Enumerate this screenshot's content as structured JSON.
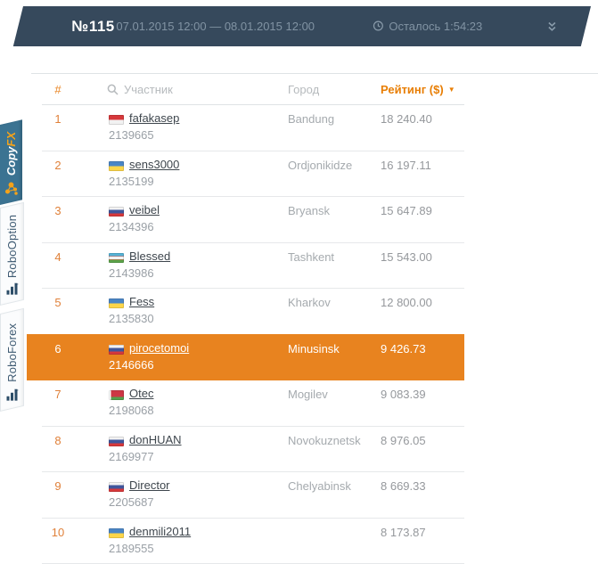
{
  "colors": {
    "topbar_bg": "#36495c",
    "accent_orange": "#e8821e",
    "row_highlight": "#e8831f",
    "copyfx_tab_bg": "#3b7392",
    "tab_text": "#3e5a72"
  },
  "topbar": {
    "contest_number": "№115",
    "period": "07.01.2015 12:00 — 08.01.2015 12:00",
    "time_left": "Осталось 1:54:23",
    "clock_icon": "clock-icon",
    "collapse_icon": "double-chevron-down-icon"
  },
  "side_tabs": {
    "copyfx": {
      "label_copy": "Copy",
      "label_fx": "FX",
      "icon": "network-molecule-icon"
    },
    "robooption": {
      "label": "RoboOption",
      "icon": "robo-bars-logo-icon"
    },
    "roboforex": {
      "label": "RoboForex",
      "icon": "robo-bars-logo-icon"
    }
  },
  "table": {
    "columns": {
      "rank": "#",
      "participant": "Участник",
      "city": "Город",
      "rating": "Рейтинг ($)"
    },
    "search_icon": "magnifier-icon",
    "sort_indicator": "▼",
    "rows": [
      {
        "rank": "1",
        "flag": "indonesia",
        "name": "fafakasep",
        "account": "2139665",
        "city": "Bandung",
        "rating": "18 240.40",
        "highlighted": false
      },
      {
        "rank": "2",
        "flag": "ukraine",
        "name": "sens3000",
        "account": "2135199",
        "city": "Ordjonikidze",
        "rating": "16 197.11",
        "highlighted": false
      },
      {
        "rank": "3",
        "flag": "russia",
        "name": "veibel",
        "account": "2134396",
        "city": "Bryansk",
        "rating": "15 647.89",
        "highlighted": false
      },
      {
        "rank": "4",
        "flag": "uzbekistan",
        "name": "Blessed",
        "account": "2143986",
        "city": "Tashkent",
        "rating": "15 543.00",
        "highlighted": false
      },
      {
        "rank": "5",
        "flag": "ukraine",
        "name": "Fess",
        "account": "2135830",
        "city": "Kharkov",
        "rating": "12 800.00",
        "highlighted": false
      },
      {
        "rank": "6",
        "flag": "russia",
        "name": "pirocetomoi",
        "account": "2146666",
        "city": "Minusinsk",
        "rating": "9 426.73",
        "highlighted": true
      },
      {
        "rank": "7",
        "flag": "belarus",
        "name": "Otec",
        "account": "2198068",
        "city": "Mogilev",
        "rating": "9 083.39",
        "highlighted": false
      },
      {
        "rank": "8",
        "flag": "russia",
        "name": "donHUAN",
        "account": "2169977",
        "city": "Novokuznetsk",
        "rating": "8 976.05",
        "highlighted": false
      },
      {
        "rank": "9",
        "flag": "russia",
        "name": "Director",
        "account": "2205687",
        "city": "Chelyabinsk",
        "rating": "8 669.33",
        "highlighted": false
      },
      {
        "rank": "10",
        "flag": "ukraine",
        "name": "denmili2011",
        "account": "2189555",
        "city": "",
        "rating": "8 173.87",
        "highlighted": false
      }
    ]
  }
}
